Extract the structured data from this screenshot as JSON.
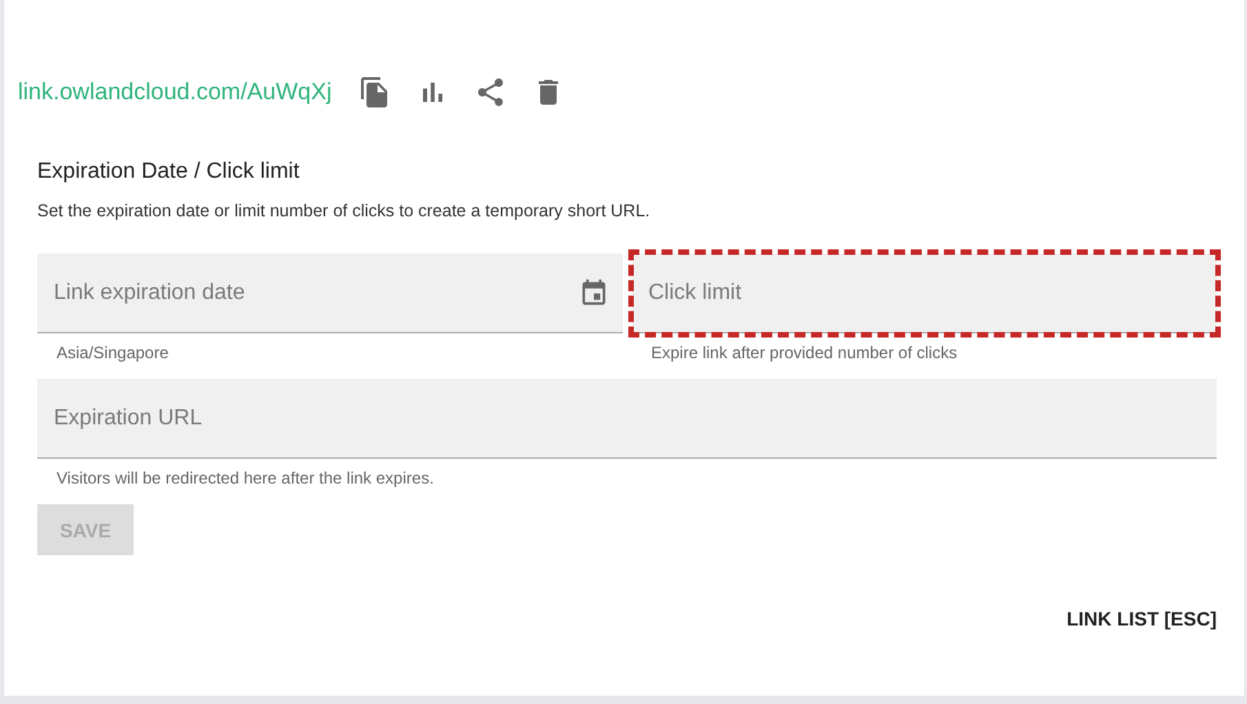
{
  "short_link": {
    "url": "link.owlandcloud.com/AuWqXj",
    "actions": [
      {
        "kind": "copy"
      },
      {
        "kind": "stats"
      },
      {
        "kind": "share"
      },
      {
        "kind": "delete"
      }
    ]
  },
  "section": {
    "title": "Expiration Date / Click limit",
    "description": "Set the expiration date or limit number of clicks to create a temporary short URL."
  },
  "fields": [
    {
      "kind": "date",
      "placeholder": "Link expiration date",
      "helper": "Asia/Singapore",
      "highlighted": false
    },
    {
      "kind": "number",
      "placeholder": "Click limit",
      "helper": "Expire link after provided number of clicks",
      "highlighted": true
    },
    {
      "kind": "url",
      "placeholder": "Expiration URL",
      "helper": "Visitors will be redirected here after the link expires.",
      "highlighted": false
    }
  ],
  "save_button": {
    "label": "SAVE",
    "disabled": true
  },
  "footer_button": {
    "label": "LINK LIST [ESC]"
  }
}
